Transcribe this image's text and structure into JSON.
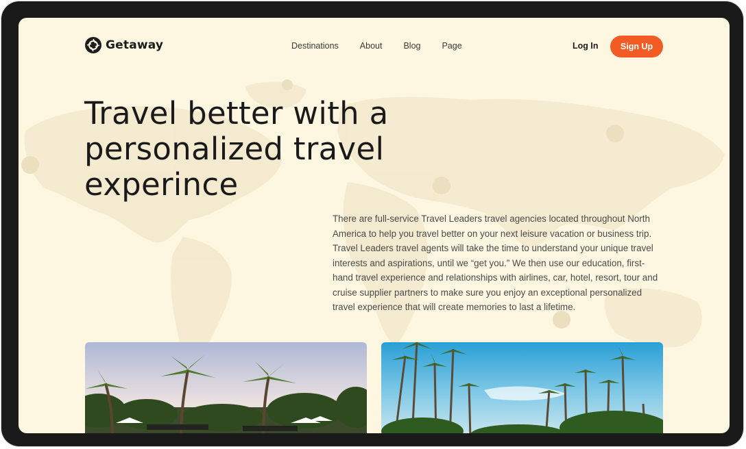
{
  "brand": {
    "name": "Getaway",
    "logo_icon": "camera-aperture-icon"
  },
  "nav": {
    "links": [
      "Destinations",
      "About",
      "Blog",
      "Page"
    ],
    "login_label": "Log In",
    "signup_label": "Sign Up"
  },
  "hero": {
    "title_lines": [
      "Travel better with a",
      "personalized travel",
      "experince"
    ],
    "description": "There are full-service Travel Leaders travel agencies located throughout North America to help you travel better on your next leisure vacation or business trip. Travel Leaders travel agents will take the time to understand your unique travel interests and aspirations, until we “get you.” We then use our education, first-hand travel experience and relationships with airlines, car, hotel, resort, tour and cruise supplier partners to make sure you enjoy an exceptional personalized travel experience that will create memories to last a lifetime."
  },
  "gallery": [
    {
      "name": "resort-palms-photo",
      "icon": "palm-tree-image"
    },
    {
      "name": "beach-palms-photo",
      "icon": "palm-tree-image"
    }
  ],
  "colors": {
    "accent": "#f35b25",
    "page_background": "#fdf6e1",
    "text": "#1a1a1a",
    "device_frame": "#1a1a1a"
  }
}
